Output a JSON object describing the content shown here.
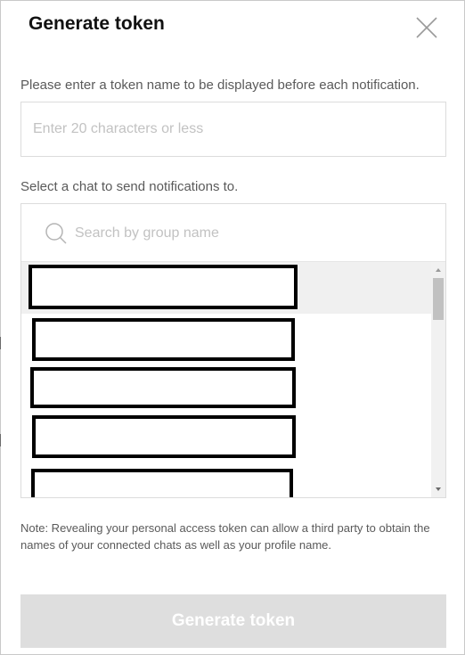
{
  "dialog": {
    "title": "Generate token",
    "close_icon": "close-x-icon"
  },
  "token_name": {
    "label": "Please enter a token name to be displayed before each notification.",
    "placeholder": "Enter 20 characters or less",
    "value": ""
  },
  "chat_select": {
    "label": "Select a chat to send notifications to.",
    "search": {
      "icon": "search-icon",
      "placeholder": "Search by group name",
      "value": ""
    },
    "items": [
      {
        "label": "",
        "redacted": true,
        "selected": true
      },
      {
        "label": "",
        "redacted": true,
        "selected": false
      },
      {
        "label": "",
        "redacted": true,
        "selected": false
      },
      {
        "label": "",
        "redacted": true,
        "selected": false
      },
      {
        "label": "",
        "redacted": true,
        "selected": false
      }
    ],
    "scrollbar": {
      "up_icon": "scroll-up-arrow-icon",
      "down_icon": "scroll-down-arrow-icon"
    }
  },
  "note": "Note: Revealing your personal access token can allow a third party to obtain the names of your connected chats as well as your profile name.",
  "generate_button": {
    "label": "Generate token",
    "enabled": false
  },
  "colors": {
    "title": "#111111",
    "label": "#5a5a5a",
    "placeholder": "#c2c2c2",
    "border": "#dcdcdc",
    "selected_row": "#f0f0f0",
    "button_disabled_bg": "#dedede",
    "button_disabled_text": "#ffffff",
    "scroll_thumb": "#c1c1c1"
  }
}
